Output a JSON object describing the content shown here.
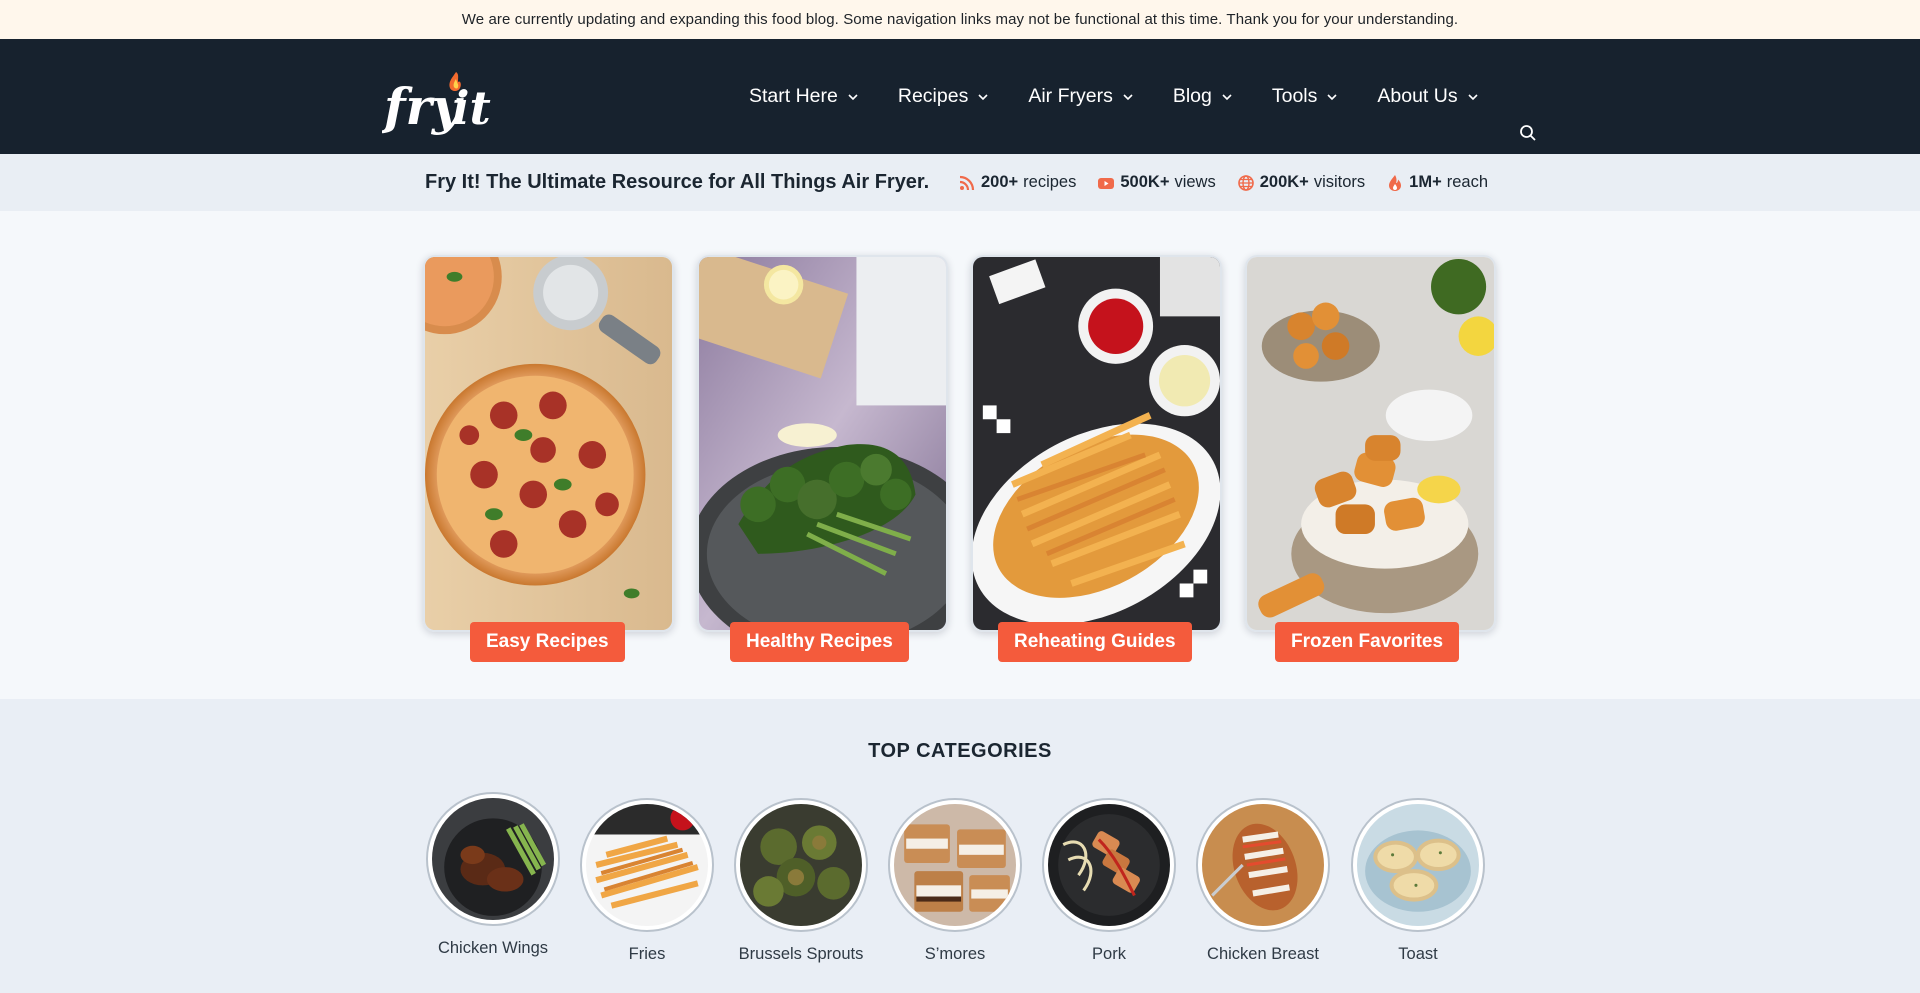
{
  "notice": {
    "text": "We are currently updating and expanding this food blog. Some navigation links may not be functional at this time. Thank you for your understanding."
  },
  "header": {
    "logo_text": "fry it",
    "nav": [
      {
        "label": "Start Here"
      },
      {
        "label": "Recipes"
      },
      {
        "label": "Air Fryers"
      },
      {
        "label": "Blog"
      },
      {
        "label": "Tools"
      },
      {
        "label": "About Us"
      }
    ],
    "search_icon": "search-icon"
  },
  "tagbar": {
    "tagline": "Fry It! The Ultimate Resource for All Things Air Fryer.",
    "stats": [
      {
        "value": "200+",
        "label": "recipes",
        "icon": "rss-icon"
      },
      {
        "value": "500K+",
        "label": "views",
        "icon": "youtube-icon"
      },
      {
        "value": "200K+",
        "label": "visitors",
        "icon": "globe-icon"
      },
      {
        "value": "1M+",
        "label": "reach",
        "icon": "flame-icon"
      }
    ]
  },
  "hero": {
    "cards": [
      {
        "label": "Easy Recipes"
      },
      {
        "label": "Healthy Recipes"
      },
      {
        "label": "Reheating Guides"
      },
      {
        "label": "Frozen Favorites"
      }
    ]
  },
  "categories": {
    "title": "TOP CATEGORIES",
    "items": [
      {
        "name": "Chicken Wings"
      },
      {
        "name": "Fries"
      },
      {
        "name": "Brussels Sprouts"
      },
      {
        "name": "S’mores"
      },
      {
        "name": "Pork"
      },
      {
        "name": "Chicken Breast"
      },
      {
        "name": "Toast"
      }
    ]
  },
  "colors": {
    "accent": "#f45b3c",
    "header_bg": "#17222e",
    "notice_bg": "#fff7ec",
    "tagbar_bg": "#e9eef4"
  }
}
